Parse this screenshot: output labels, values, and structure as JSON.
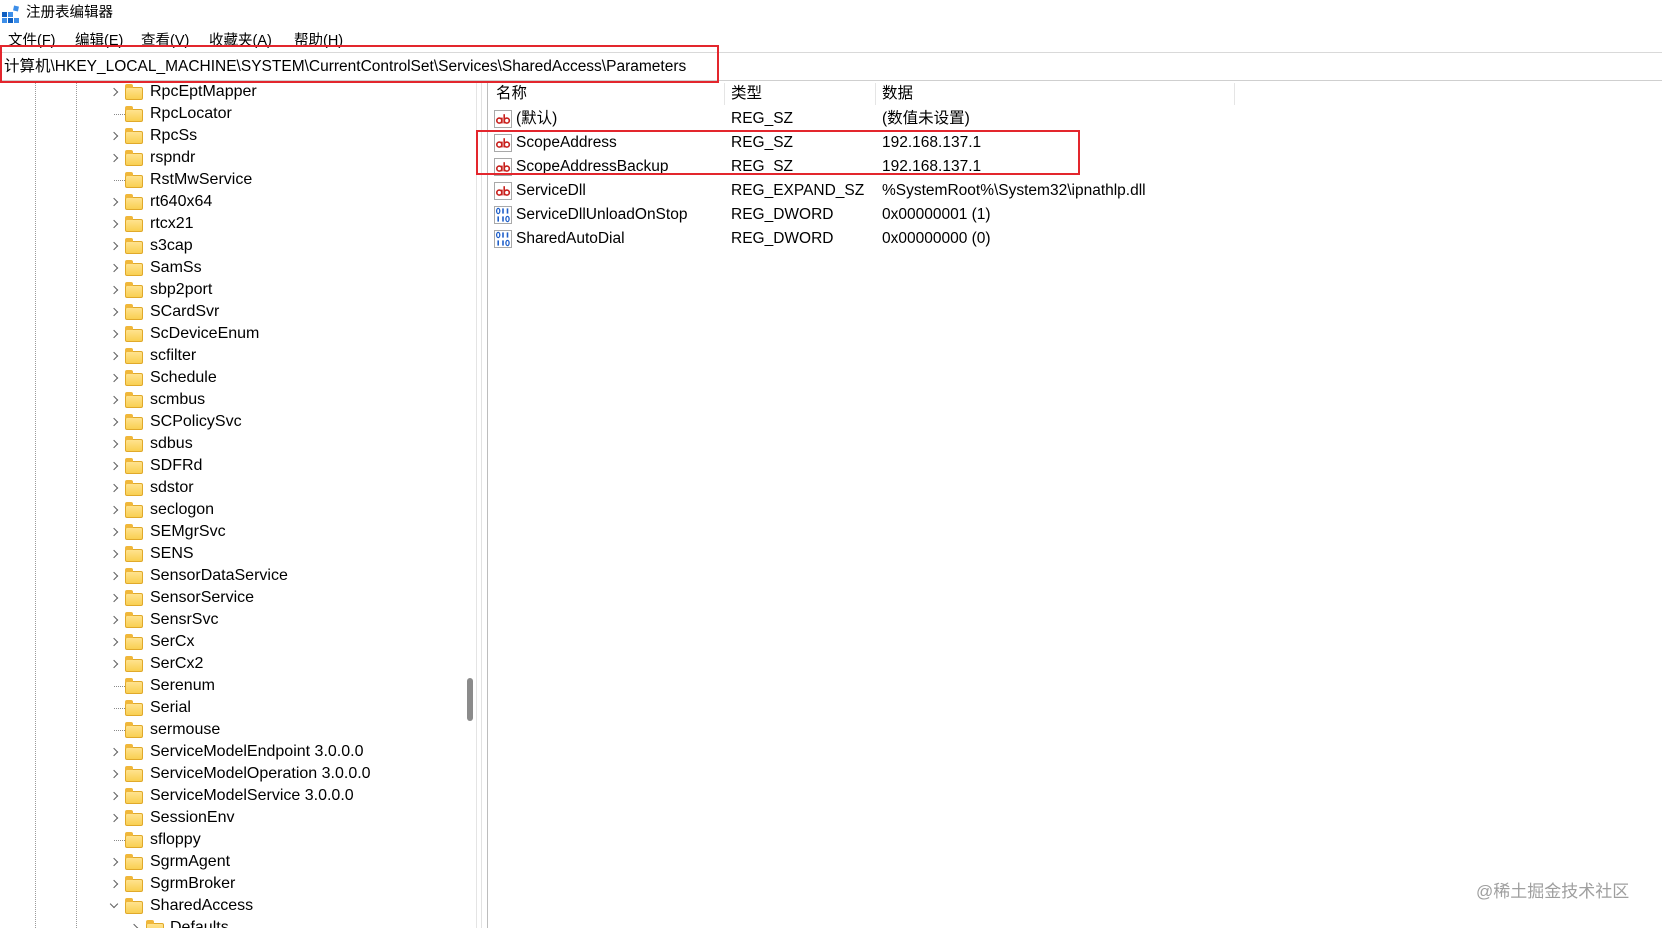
{
  "window": {
    "title": "注册表编辑器",
    "icon": "registry-editor-icon"
  },
  "menu": {
    "items": [
      {
        "label": "文件(F)"
      },
      {
        "label": "编辑(E)"
      },
      {
        "label": "查看(V)"
      },
      {
        "label": "收藏夹(A)"
      },
      {
        "label": "帮助(H)"
      }
    ]
  },
  "address_bar": {
    "path": "计算机\\HKEY_LOCAL_MACHINE\\SYSTEM\\CurrentControlSet\\Services\\SharedAccess\\Parameters"
  },
  "tree": {
    "items": [
      {
        "label": "RpcEptMapper",
        "state": "collapsed",
        "depth": 0
      },
      {
        "label": "RpcLocator",
        "state": "leaf",
        "depth": 0
      },
      {
        "label": "RpcSs",
        "state": "collapsed",
        "depth": 0
      },
      {
        "label": "rspndr",
        "state": "collapsed",
        "depth": 0
      },
      {
        "label": "RstMwService",
        "state": "leaf",
        "depth": 0
      },
      {
        "label": "rt640x64",
        "state": "collapsed",
        "depth": 0
      },
      {
        "label": "rtcx21",
        "state": "collapsed",
        "depth": 0
      },
      {
        "label": "s3cap",
        "state": "collapsed",
        "depth": 0
      },
      {
        "label": "SamSs",
        "state": "collapsed",
        "depth": 0
      },
      {
        "label": "sbp2port",
        "state": "collapsed",
        "depth": 0
      },
      {
        "label": "SCardSvr",
        "state": "collapsed",
        "depth": 0
      },
      {
        "label": "ScDeviceEnum",
        "state": "collapsed",
        "depth": 0
      },
      {
        "label": "scfilter",
        "state": "collapsed",
        "depth": 0
      },
      {
        "label": "Schedule",
        "state": "collapsed",
        "depth": 0
      },
      {
        "label": "scmbus",
        "state": "collapsed",
        "depth": 0
      },
      {
        "label": "SCPolicySvc",
        "state": "collapsed",
        "depth": 0
      },
      {
        "label": "sdbus",
        "state": "collapsed",
        "depth": 0
      },
      {
        "label": "SDFRd",
        "state": "collapsed",
        "depth": 0
      },
      {
        "label": "sdstor",
        "state": "collapsed",
        "depth": 0
      },
      {
        "label": "seclogon",
        "state": "collapsed",
        "depth": 0
      },
      {
        "label": "SEMgrSvc",
        "state": "collapsed",
        "depth": 0
      },
      {
        "label": "SENS",
        "state": "collapsed",
        "depth": 0
      },
      {
        "label": "SensorDataService",
        "state": "collapsed",
        "depth": 0
      },
      {
        "label": "SensorService",
        "state": "collapsed",
        "depth": 0
      },
      {
        "label": "SensrSvc",
        "state": "collapsed",
        "depth": 0
      },
      {
        "label": "SerCx",
        "state": "collapsed",
        "depth": 0
      },
      {
        "label": "SerCx2",
        "state": "collapsed",
        "depth": 0
      },
      {
        "label": "Serenum",
        "state": "leaf",
        "depth": 0
      },
      {
        "label": "Serial",
        "state": "leaf",
        "depth": 0
      },
      {
        "label": "sermouse",
        "state": "leaf",
        "depth": 0
      },
      {
        "label": "ServiceModelEndpoint 3.0.0.0",
        "state": "collapsed",
        "depth": 0
      },
      {
        "label": "ServiceModelOperation 3.0.0.0",
        "state": "collapsed",
        "depth": 0
      },
      {
        "label": "ServiceModelService 3.0.0.0",
        "state": "collapsed",
        "depth": 0
      },
      {
        "label": "SessionEnv",
        "state": "collapsed",
        "depth": 0
      },
      {
        "label": "sfloppy",
        "state": "leaf",
        "depth": 0
      },
      {
        "label": "SgrmAgent",
        "state": "collapsed",
        "depth": 0
      },
      {
        "label": "SgrmBroker",
        "state": "collapsed",
        "depth": 0
      },
      {
        "label": "SharedAccess",
        "state": "expanded",
        "depth": 0
      },
      {
        "label": "Defaults",
        "state": "collapsed",
        "depth": 1
      }
    ]
  },
  "values_list": {
    "columns": {
      "name": "名称",
      "type": "类型",
      "data": "数据"
    },
    "rows": [
      {
        "icon": "string-value-icon",
        "name": "(默认)",
        "type": "REG_SZ",
        "data": "(数值未设置)"
      },
      {
        "icon": "string-value-icon",
        "name": "ScopeAddress",
        "type": "REG_SZ",
        "data": "192.168.137.1"
      },
      {
        "icon": "string-value-icon",
        "name": "ScopeAddressBackup",
        "type": "REG_SZ",
        "data": "192.168.137.1"
      },
      {
        "icon": "string-value-icon",
        "name": "ServiceDll",
        "type": "REG_EXPAND_SZ",
        "data": "%SystemRoot%\\System32\\ipnathlp.dll"
      },
      {
        "icon": "dword-value-icon",
        "name": "ServiceDllUnloadOnStop",
        "type": "REG_DWORD",
        "data": "0x00000001 (1)"
      },
      {
        "icon": "dword-value-icon",
        "name": "SharedAutoDial",
        "type": "REG_DWORD",
        "data": "0x00000000 (0)"
      }
    ]
  },
  "watermark": "@稀土掘金技术社区",
  "colors": {
    "annotation_box": "#e3262d",
    "folder": "#f9cf52",
    "string_icon": "#c8201c",
    "dword_icon": "#1f5fc9",
    "watermark": "#9f9f9f"
  }
}
